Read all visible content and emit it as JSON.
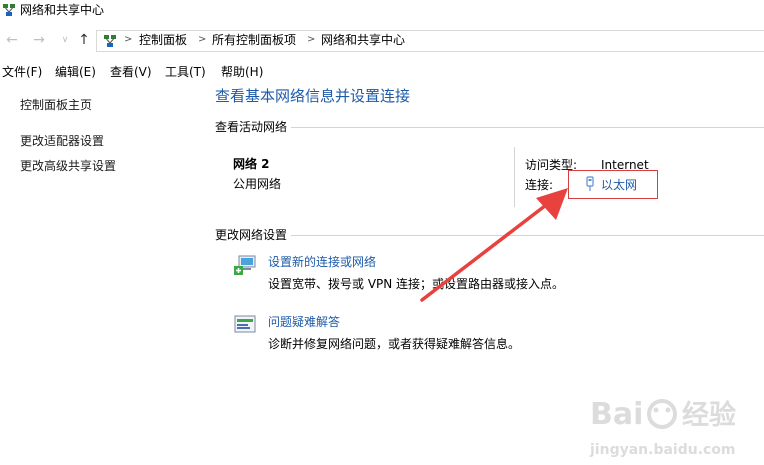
{
  "window": {
    "title": "网络和共享中心"
  },
  "nav": {
    "back_icon": "back-arrow-icon",
    "forward_icon": "forward-arrow-icon",
    "recent_icon": "chevron-down-icon",
    "up_icon": "up-arrow-icon",
    "breadcrumbs": [
      "控制面板",
      "所有控制面板项",
      "网络和共享中心"
    ]
  },
  "menu": [
    "文件(F)",
    "编辑(E)",
    "查看(V)",
    "工具(T)",
    "帮助(H)"
  ],
  "sidebar": {
    "home": "控制面板主页",
    "items": [
      "更改适配器设置",
      "更改高级共享设置"
    ]
  },
  "main": {
    "title": "查看基本网络信息并设置连接",
    "active_networks_heading": "查看活动网络",
    "network": {
      "name": "网络  2",
      "category": "公用网络",
      "access_type_label": "访问类型:",
      "access_type_value": "Internet",
      "connection_label": "连接:",
      "connection_value": "以太网"
    },
    "change_settings_heading": "更改网络设置",
    "tasks": [
      {
        "link": "设置新的连接或网络",
        "desc": "设置宽带、拨号或 VPN 连接；或设置路由器或接入点。",
        "icon": "new-connection-icon"
      },
      {
        "link": "问题疑难解答",
        "desc": "诊断并修复网络问题，或者获得疑难解答信息。",
        "icon": "troubleshoot-icon"
      }
    ]
  },
  "annotation": {
    "box_color": "#d73d3d",
    "arrow_color": "#e8423e"
  },
  "watermark": {
    "brand": "Bai",
    "brand_suffix": "经验",
    "url": "jingyan.baidu.com"
  },
  "colors": {
    "link": "#1e5ba8",
    "title": "#1e5ba8"
  }
}
